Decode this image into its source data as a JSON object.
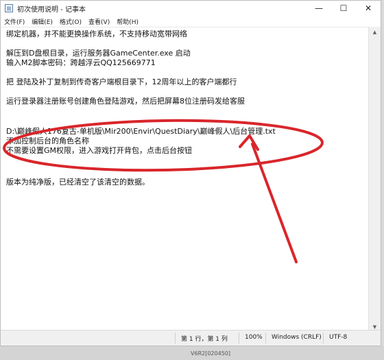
{
  "window": {
    "title": "初次使用说明 - 记事本",
    "controls": {
      "minimize": "—",
      "maximize": "☐",
      "close": "✕"
    }
  },
  "menu": [
    "文件(F)",
    "编辑(E)",
    "格式(O)",
    "查看(V)",
    "帮助(H)"
  ],
  "content": {
    "lines": [
      "绑定机器，并不能更换操作系统，不支持移动宽带网络",
      "",
      "解压到D盘根目录，运行服务器GameCenter.exe 启动",
      "输入M2脚本密码：跨越浮云QQ125669771",
      "",
      "把 登陆及补丁复制到传奇客户端根目录下，12周年以上的客户端都行",
      "",
      "运行登录器注册账号创建角色登陆游戏，然后把屏幕8位注册码发给客服",
      "",
      "",
      "D:\\巅峰假人176复古-单机版\\Mir200\\Envir\\QuestDiary\\巅峰假人\\后台管理.txt",
      "添加控制后台的角色名称",
      "不需要设置GM权限，进入游戏打开背包，点击后台按钮",
      "",
      "",
      "版本为纯净版，已经清空了该清空的数据。"
    ]
  },
  "status": {
    "position": "第 1 行，第 1 列",
    "zoom": "100%",
    "line_ending": "Windows (CRLF)",
    "encoding": "UTF-8"
  },
  "taskbar": {
    "label": "V6R2[020450]"
  },
  "annotation": {
    "color": "#d9262b"
  },
  "scrollbar": {
    "up_icon": "▲",
    "down_icon": "▼"
  }
}
